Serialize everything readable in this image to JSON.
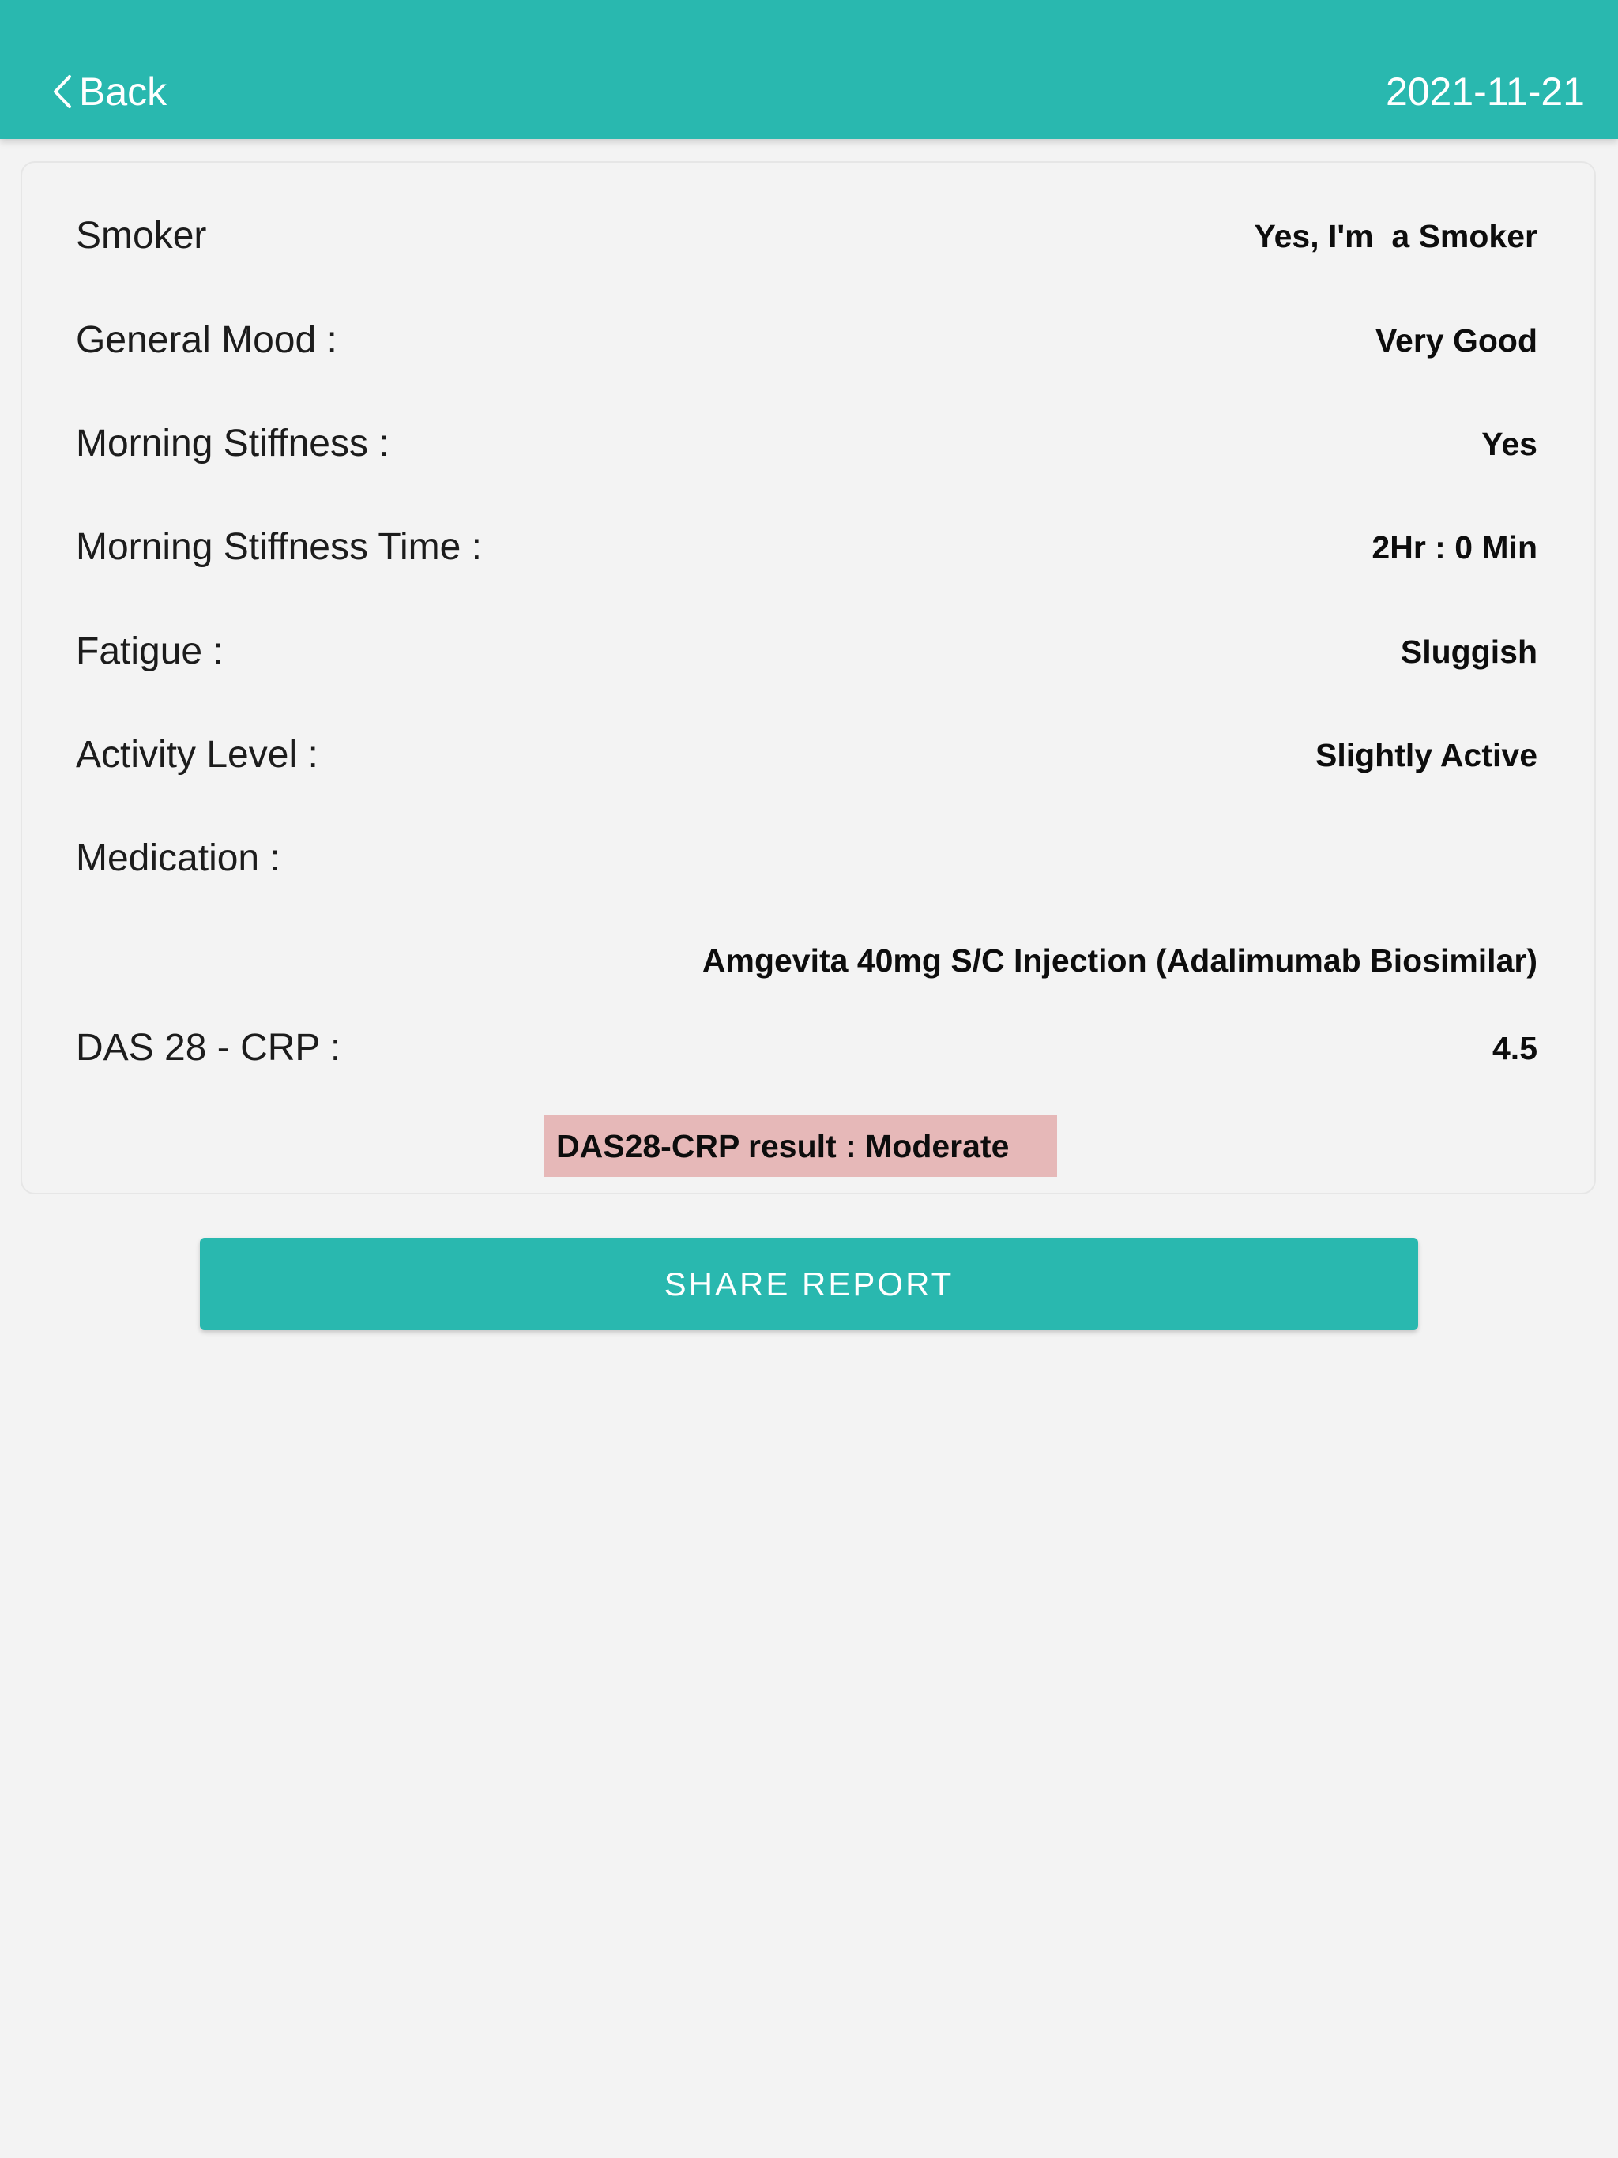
{
  "header": {
    "back_label": "Back",
    "date": "2021-11-21",
    "color": "#29b8af"
  },
  "report": {
    "rows": [
      {
        "label": "Smoker",
        "value": "Yes, I'm  a Smoker"
      },
      {
        "label": "General Mood :",
        "value": "Very Good"
      },
      {
        "label": "Morning Stiffness :",
        "value": "Yes"
      },
      {
        "label": "Morning Stiffness Time :",
        "value": "2Hr : 0 Min"
      },
      {
        "label": "Fatigue :",
        "value": "Sluggish"
      },
      {
        "label": "Activity Level :",
        "value": "Slightly Active"
      },
      {
        "label": "Medication :",
        "value": "Amgevita 40mg S/C Injection (Adalimumab Biosimilar)"
      },
      {
        "label": "DAS 28 - CRP :",
        "value": "4.5"
      }
    ],
    "result": "DAS28-CRP result : Moderate",
    "result_color": "#e6b8b8"
  },
  "share_label": "SHARE REPORT",
  "icons": {
    "back": "chevron-left-icon"
  }
}
